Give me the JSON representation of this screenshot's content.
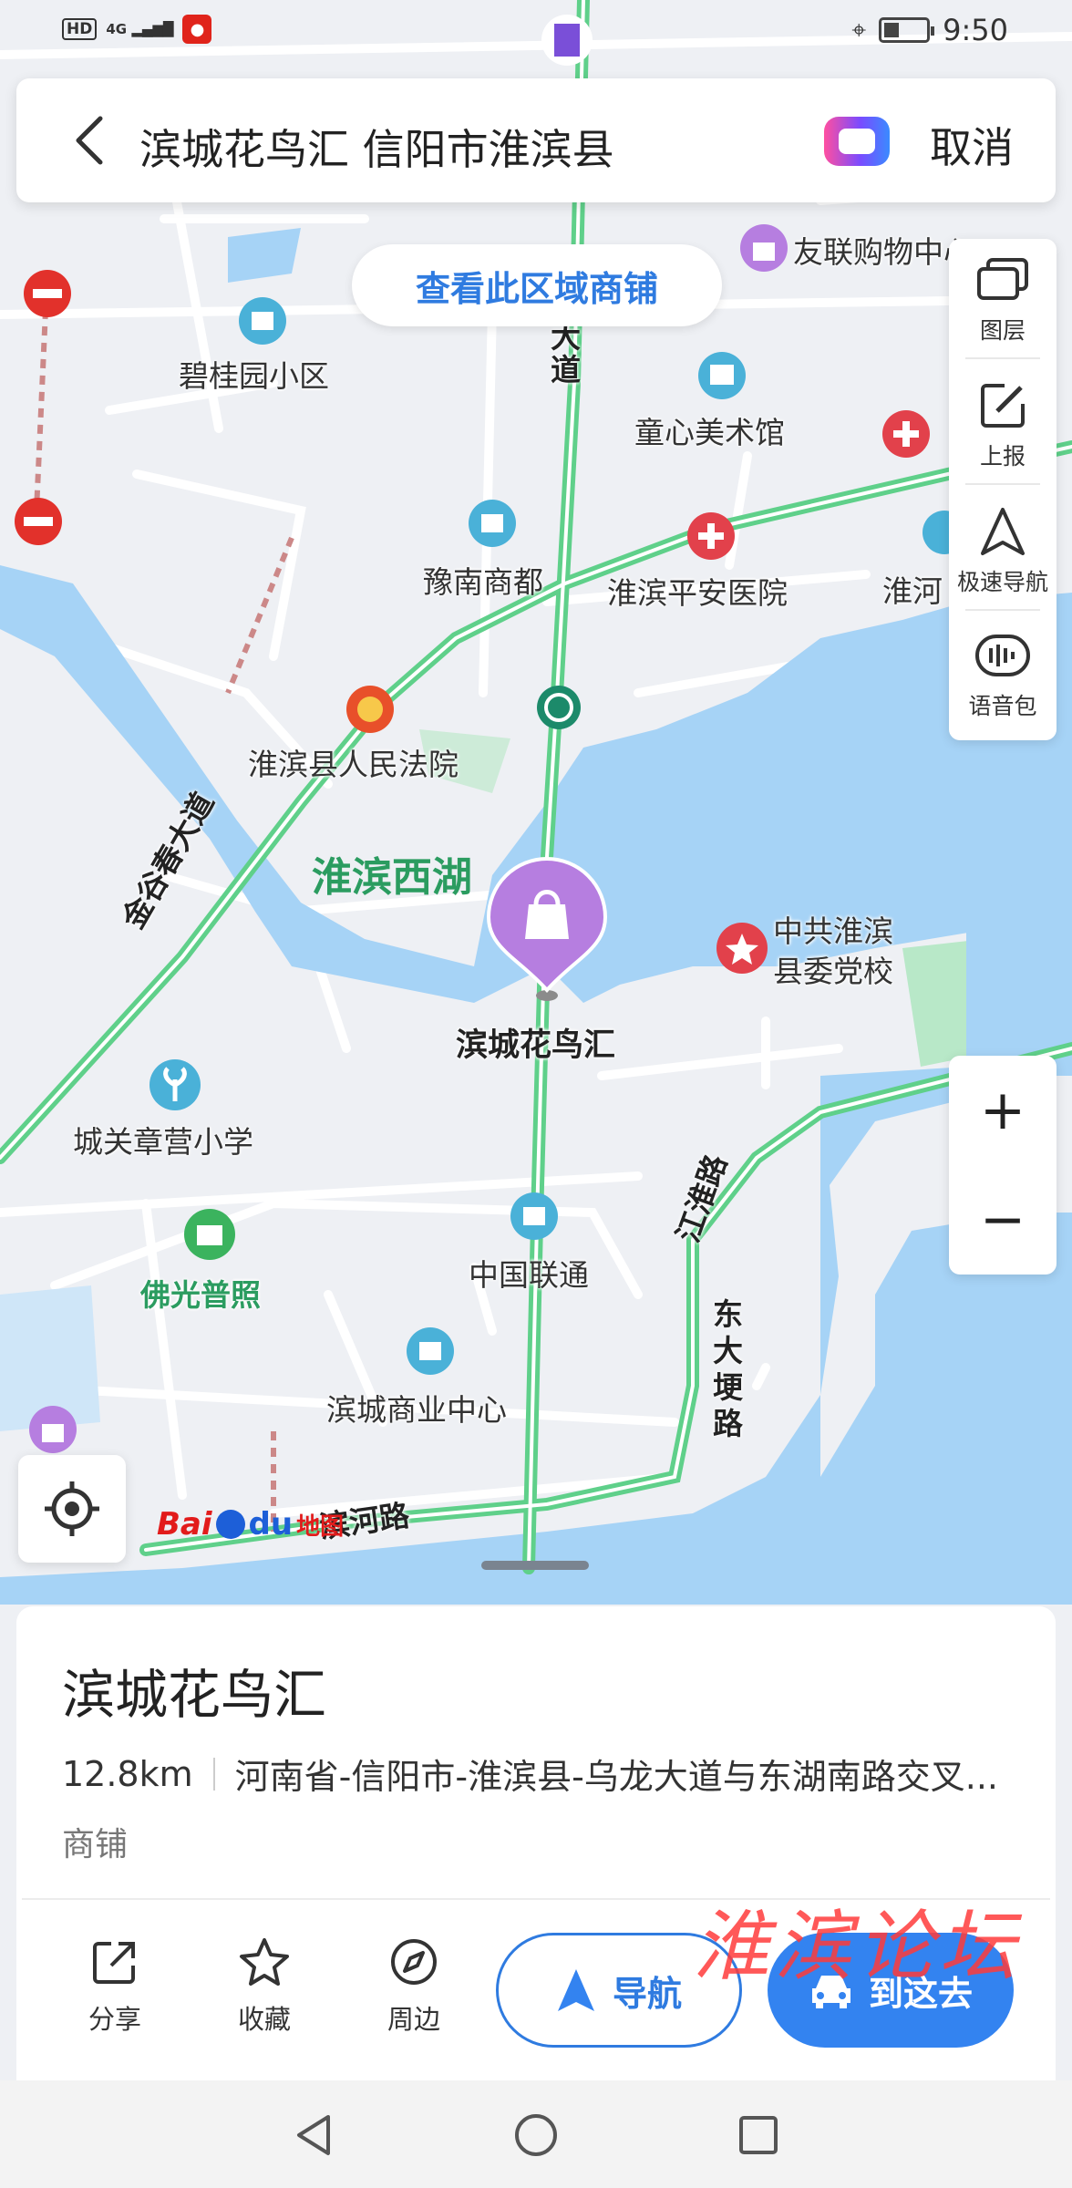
{
  "status_bar": {
    "network_badge": "HD",
    "signal": "4G",
    "time": "9:50"
  },
  "search": {
    "query": "滨城花鸟汇 信阳市淮滨县",
    "cancel_label": "取消"
  },
  "map": {
    "area_shops_button": "查看此区域商铺",
    "tools": [
      {
        "label": "图层",
        "icon": "layers-icon"
      },
      {
        "label": "上报",
        "icon": "report-edit-icon"
      },
      {
        "label": "极速导航",
        "icon": "fast-navigation-icon"
      },
      {
        "label": "语音包",
        "icon": "voice-pack-icon"
      }
    ],
    "zoom_in": "+",
    "zoom_out": "−",
    "selected_pin_label": "滨城花鸟汇",
    "pois": {
      "youlian": "友联购物中心",
      "biguiyuan": "碧桂园小区",
      "tongxin": "童心美术馆",
      "yunan": "豫南商都",
      "pingan": "淮滨平安医院",
      "huaihe": "淮河",
      "court": "淮滨县人民法院",
      "party_school": "中共淮滨\n县委党校",
      "chengguan": "城关章营小学",
      "foguang": "佛光普照",
      "unicom": "中国联通",
      "commerce": "滨城商业中心"
    },
    "lake_label": "淮滨西湖",
    "roads": {
      "dadao": "大\n道",
      "jingu": "金谷春大道",
      "jianghuai": "江淮路",
      "dongdageng": "东大埂路",
      "binhe": "滨河路"
    },
    "logo": {
      "bai": "Bai",
      "du": "du",
      "ditu": "地图"
    },
    "colors": {
      "water": "#a6d3f6",
      "road_green": "#5fd08a",
      "park": "#b8e8c8",
      "accent": "#3383f0",
      "pin_purple": "#b67ee0"
    }
  },
  "place": {
    "name": "滨城花鸟汇",
    "distance": "12.8km",
    "address": "河南省-信阳市-淮滨县-乌龙大道与东湖南路交叉...",
    "category": "商铺"
  },
  "actions": {
    "share": "分享",
    "favorite": "收藏",
    "nearby": "周边",
    "navigate": "导航",
    "go_here": "到这去"
  },
  "watermark": "淮滨论坛"
}
